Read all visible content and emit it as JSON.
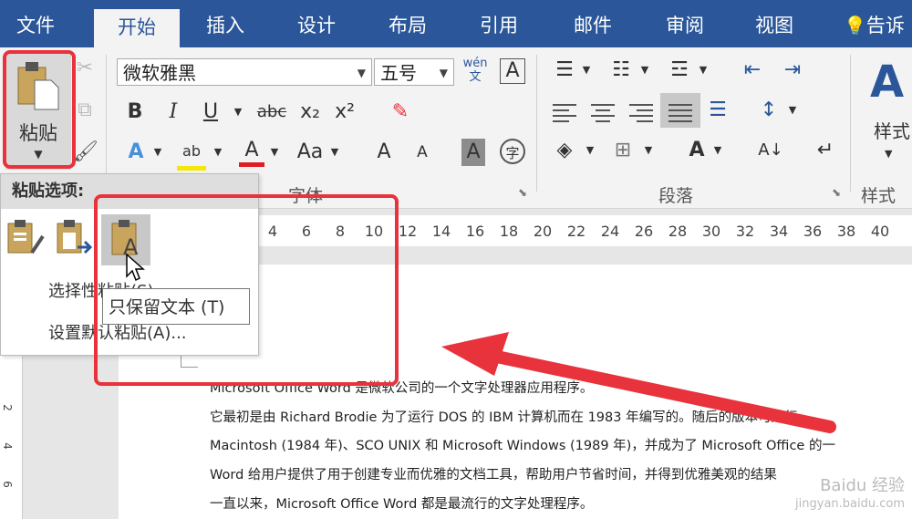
{
  "tabs": [
    {
      "label": "文件",
      "active": false
    },
    {
      "label": "开始",
      "active": true
    },
    {
      "label": "插入",
      "active": false
    },
    {
      "label": "设计",
      "active": false
    },
    {
      "label": "布局",
      "active": false
    },
    {
      "label": "引用",
      "active": false
    },
    {
      "label": "邮件",
      "active": false
    },
    {
      "label": "审阅",
      "active": false
    },
    {
      "label": "视图",
      "active": false
    }
  ],
  "tell_me": "告诉",
  "clipboard": {
    "paste_label": "粘贴"
  },
  "font": {
    "name": "微软雅黑",
    "size": "五号",
    "bold": "B",
    "italic": "I",
    "underline": "U",
    "strike": "abc",
    "subscript": "x₂",
    "superscript": "x²",
    "grow": "A",
    "shrink": "A",
    "case": "Aa",
    "phonetic": "wén 文",
    "border_char": "A",
    "char_shade": "A",
    "enclose": "字",
    "group_label": "字体"
  },
  "paragraph": {
    "group_label": "段落"
  },
  "styles": {
    "label": "样式",
    "group_label": "样式"
  },
  "ruler_ticks": [
    "4",
    "6",
    "8",
    "10",
    "12",
    "14",
    "16",
    "18",
    "20",
    "22",
    "24",
    "26",
    "28",
    "30",
    "32",
    "34",
    "36",
    "38",
    "40"
  ],
  "left_ruler": [
    "2",
    "4",
    "6"
  ],
  "paste_menu": {
    "header": "粘贴选项:",
    "item1": "选择性粘贴(S)...",
    "item2": "设置默认粘贴(A)..."
  },
  "tooltip": "只保留文本 (T)",
  "document": {
    "lines": [
      "Microsoft Office Word 是微软公司的一个文字处理器应用程序。",
      "它最初是由 Richard Brodie 为了运行 DOS 的 IBM 计算机而在 1983 年编写的。随后的版本可运行",
      "Macintosh (1984 年)、SCO UNIX 和 Microsoft Windows (1989 年)，并成为了 Microsoft Office 的一",
      "Word 给用户提供了用于创建专业而优雅的文档工具，帮助用户节省时间，并得到优雅美观的结果",
      "一直以来，Microsoft Office Word  都是最流行的文字处理程序。"
    ]
  },
  "watermark": {
    "line1": "Baidu 经验",
    "line2": "jingyan.baidu.com"
  },
  "colors": {
    "accent": "#2b579a",
    "highlight": "#e8323c"
  }
}
